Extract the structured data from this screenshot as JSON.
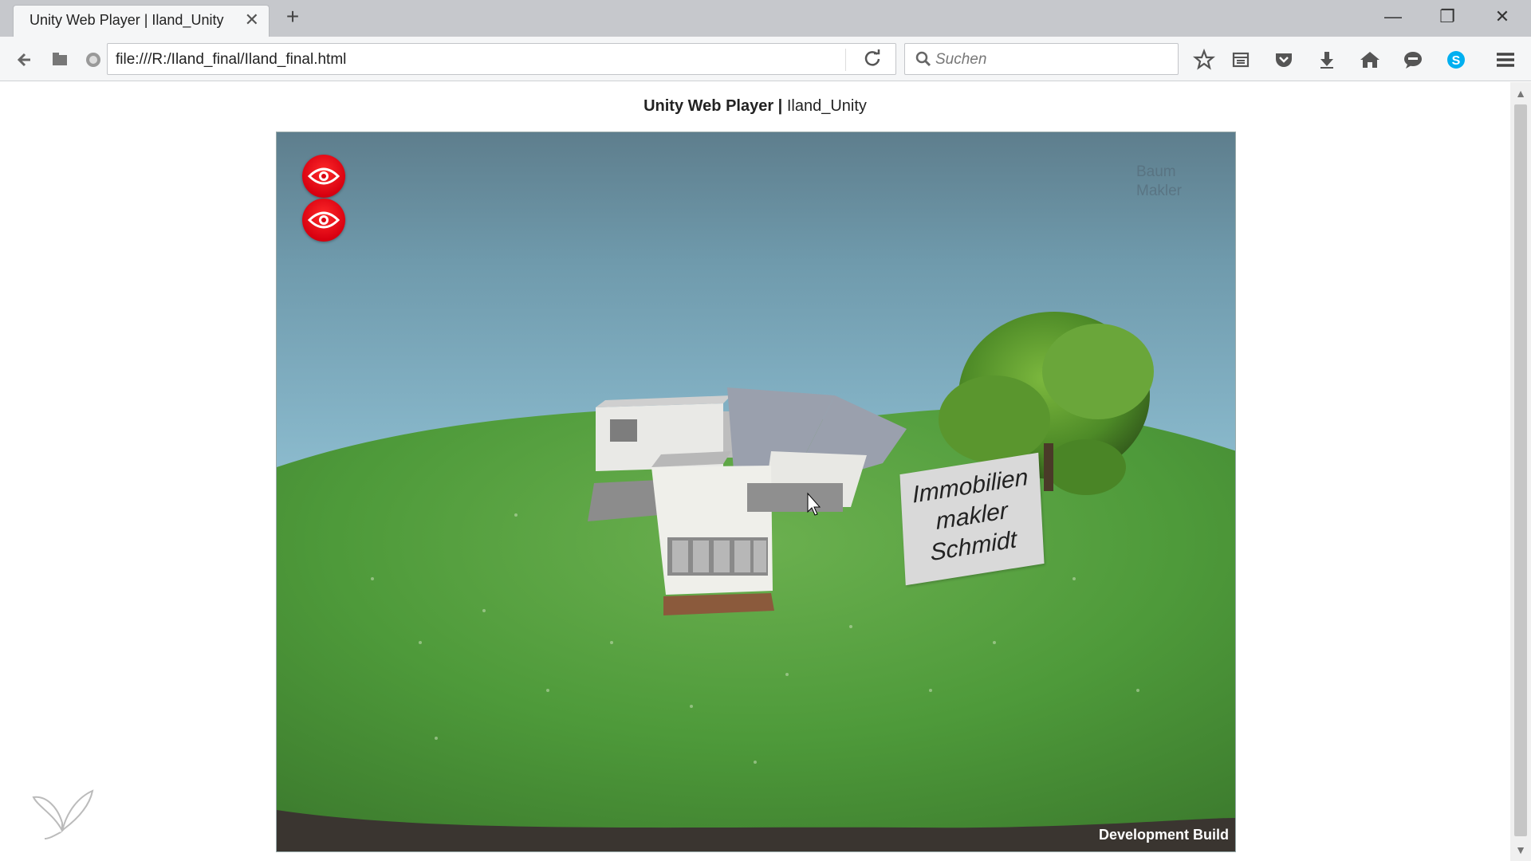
{
  "browser": {
    "tab_title": "Unity Web Player | Iland_Unity",
    "tab_close": "✕",
    "new_tab": "+",
    "window_controls": {
      "minimize": "—",
      "restore": "❐",
      "close": "✕"
    },
    "url": "file:///R:/Iland_final/Iland_final.html",
    "search_placeholder": "Suchen",
    "toolbar_icons": [
      "star-icon",
      "library-icon",
      "pocket-icon",
      "download-icon",
      "home-icon",
      "chat-icon",
      "skype-icon",
      "menu-icon"
    ],
    "colors": {
      "skype": "#00aff0"
    }
  },
  "page": {
    "heading_bold": "Unity Web Player |",
    "heading_rest": " Iland_Unity"
  },
  "unity": {
    "hud_labels": [
      "Baum",
      "Makler"
    ],
    "sign_lines": [
      "Immobilien",
      "makler",
      "Schmidt"
    ],
    "dev_build": "Development Build",
    "colors": {
      "eye_button": "#e0001a",
      "grass": "#4e9a3a",
      "sky": "#8fc1d4"
    }
  }
}
